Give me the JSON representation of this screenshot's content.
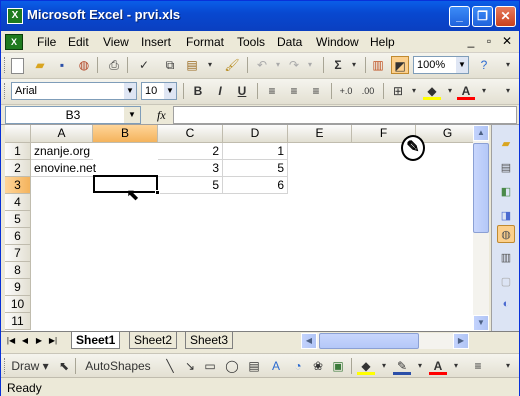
{
  "window": {
    "title": "Microsoft Excel - prvi.xls",
    "minimize": "_",
    "restore": "❐",
    "close": "✕"
  },
  "menu": {
    "items": [
      "File",
      "Edit",
      "View",
      "Insert",
      "Format",
      "Tools",
      "Data",
      "Window",
      "Help"
    ],
    "minimize": "_",
    "restore": "▫",
    "close": "✕"
  },
  "standard_toolbar": {
    "zoom": "100%",
    "icons": [
      "new-icon",
      "open-icon",
      "save-icon",
      "permission-icon",
      "print-icon",
      "print-preview-icon",
      "spelling-icon",
      "copy-icon",
      "paste-icon",
      "format-painter-icon",
      "undo-icon",
      "redo-icon",
      "autosum-icon",
      "chart-wizard-icon",
      "drawing-icon",
      "help-icon"
    ]
  },
  "formatting_toolbar": {
    "font": "Arial",
    "size": "10",
    "bold": "B",
    "italic": "I",
    "underline": "U"
  },
  "formula_bar": {
    "name_box": "B3",
    "fx": "fx",
    "formula": ""
  },
  "sheet": {
    "columns": [
      "A",
      "B",
      "C",
      "D",
      "E",
      "F",
      "G"
    ],
    "rows": [
      "1",
      "2",
      "3",
      "4",
      "5",
      "6",
      "7",
      "8",
      "9",
      "10",
      "11"
    ],
    "cells": {
      "A1": "znanje.org",
      "C1": "2",
      "D1": "1",
      "A2": "enovine.net",
      "C2": "3",
      "D2": "5",
      "C3": "5",
      "D3": "6"
    },
    "active_cell": "B3"
  },
  "tabs": {
    "sheets": [
      "Sheet1",
      "Sheet2",
      "Sheet3"
    ],
    "active": "Sheet1"
  },
  "drawing_toolbar": {
    "draw": "Draw ▾",
    "autoshapes": "AutoShapes ▾"
  },
  "status": {
    "text": "Ready"
  },
  "colors": {
    "title_bar": "#0a5ee8",
    "selection_header": "#f4b35c",
    "fill_color": "#ffff00",
    "font_color": "#ff0000"
  }
}
